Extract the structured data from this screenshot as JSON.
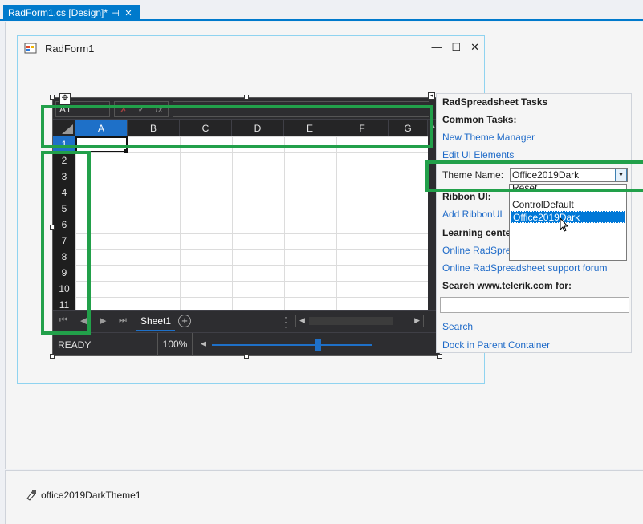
{
  "tab": {
    "title": "RadForm1.cs [Design]*",
    "pin_glyph": "⊣",
    "close_glyph": "✕"
  },
  "form": {
    "title": "RadForm1",
    "min_glyph": "—",
    "max_glyph": "☐",
    "close_glyph": "✕"
  },
  "spreadsheet": {
    "name_box": "A1",
    "fx_cancel": "✗",
    "fx_confirm": "✓",
    "fx_label": "fx",
    "columns": [
      "A",
      "B",
      "C",
      "D",
      "E",
      "F",
      "G"
    ],
    "rows": [
      "1",
      "2",
      "3",
      "4",
      "5",
      "6",
      "7",
      "8",
      "9",
      "10",
      "11"
    ],
    "sheet_tab": "Sheet1",
    "status": "READY",
    "zoom": "100%"
  },
  "tasks": {
    "title": "RadSpreadsheet Tasks",
    "common_tasks": "Common Tasks:",
    "new_theme_manager": "New Theme Manager",
    "edit_ui_elements": "Edit UI Elements",
    "theme_name_label": "Theme Name:",
    "theme_selected": "Office2019Dark",
    "theme_options": [
      "Reset",
      "ControlDefault",
      "Office2019Dark"
    ],
    "ribbon_ui": "Ribbon UI:",
    "add_ribbonui": "Add RibbonUI",
    "learning_center": "Learning cente",
    "online_radspre": "Online RadSpre",
    "online_forum": "Online RadSpreadsheet support forum",
    "search_label": "Search www.telerik.com for:",
    "search_link": "Search",
    "dock_link": "Dock in Parent Container"
  },
  "tray": {
    "component": "office2019DarkTheme1"
  },
  "colors": {
    "accent": "#007acc",
    "highlight": "#22a04a",
    "selection": "#1e70c8"
  }
}
